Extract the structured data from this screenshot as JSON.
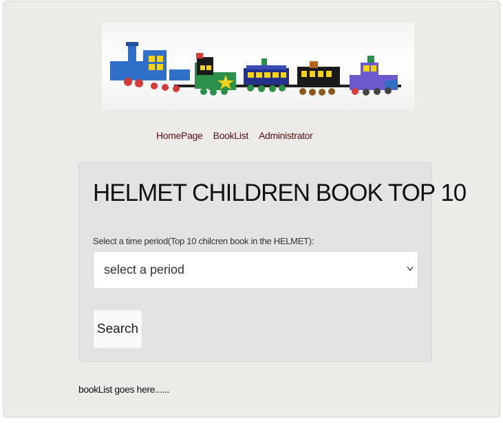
{
  "banner": {
    "image": "toy-train-banner"
  },
  "nav": {
    "items": [
      {
        "label": "HomePage"
      },
      {
        "label": "BookList"
      },
      {
        "label": "Administrator"
      }
    ],
    "color": "#5a0f12"
  },
  "panel": {
    "title": "HELMET CHILDREN BOOK TOP 10",
    "select_label": "Select a time period(Top 10 chilcren book in the HELMET):",
    "select_value": "select a period",
    "search_label": "Search"
  },
  "booklist_text": "bookList goes here......"
}
